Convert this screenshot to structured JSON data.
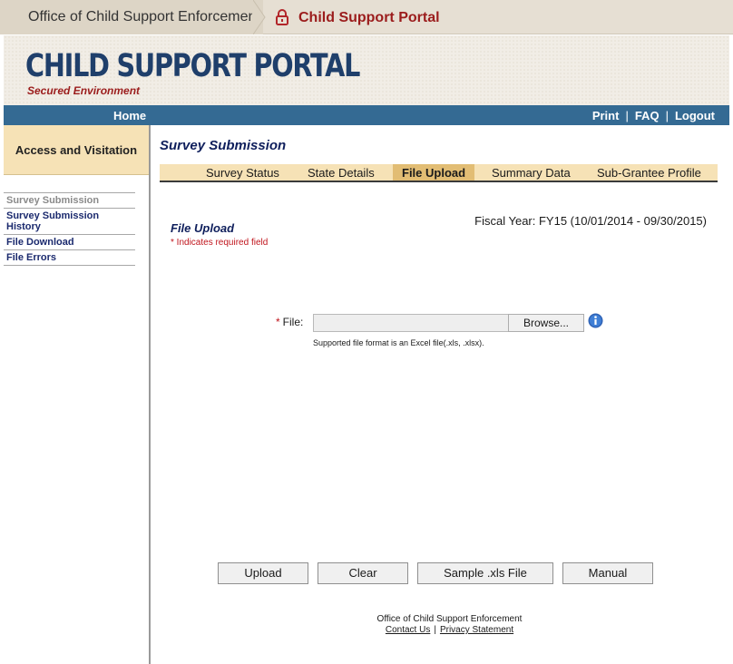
{
  "header": {
    "org_name": "Office of Child Support Enforcement",
    "portal_name": "Child Support Portal"
  },
  "banner": {
    "title": "CHILD SUPPORT PORTAL",
    "subtitle": "Secured Environment"
  },
  "nav": {
    "home": "Home",
    "print": "Print",
    "faq": "FAQ",
    "logout": "Logout",
    "separator": "|"
  },
  "sidebar": {
    "heading": "Access and Visitation",
    "items": [
      {
        "label": "Survey Submission",
        "active": true
      },
      {
        "label": "Survey Submission History",
        "active": false
      },
      {
        "label": "File Download",
        "active": false
      },
      {
        "label": "File Errors",
        "active": false
      }
    ]
  },
  "main": {
    "page_title": "Survey Submission",
    "tabs": [
      {
        "label": "Survey Status",
        "active": false
      },
      {
        "label": "State Details",
        "active": false
      },
      {
        "label": "File Upload",
        "active": true
      },
      {
        "label": "Summary Data",
        "active": false
      },
      {
        "label": "Sub-Grantee Profile",
        "active": false
      }
    ],
    "section_title": "File Upload",
    "required_note": "* Indicates required field",
    "fiscal_year": "Fiscal Year: FY15 (10/01/2014 - 09/30/2015)",
    "file_field": {
      "required_marker": "*",
      "label": "File:",
      "value": "",
      "browse_label": "Browse...",
      "hint": "Supported file format is an Excel file(.xls, .xlsx)."
    },
    "buttons": {
      "upload": "Upload",
      "clear": "Clear",
      "sample": "Sample .xls File",
      "manual": "Manual"
    }
  },
  "footer": {
    "org": "Office of Child Support Enforcement",
    "contact": "Contact Us",
    "separator": "|",
    "privacy": "Privacy Statement"
  },
  "colors": {
    "brand_blue": "#346a93",
    "title_navy": "#1f3f6b",
    "accent_red": "#9b1c1c",
    "tab_bg": "#f6e2b6",
    "tab_active": "#e2bd74"
  },
  "icons": {
    "lock": "lock-icon",
    "info": "info-icon"
  }
}
